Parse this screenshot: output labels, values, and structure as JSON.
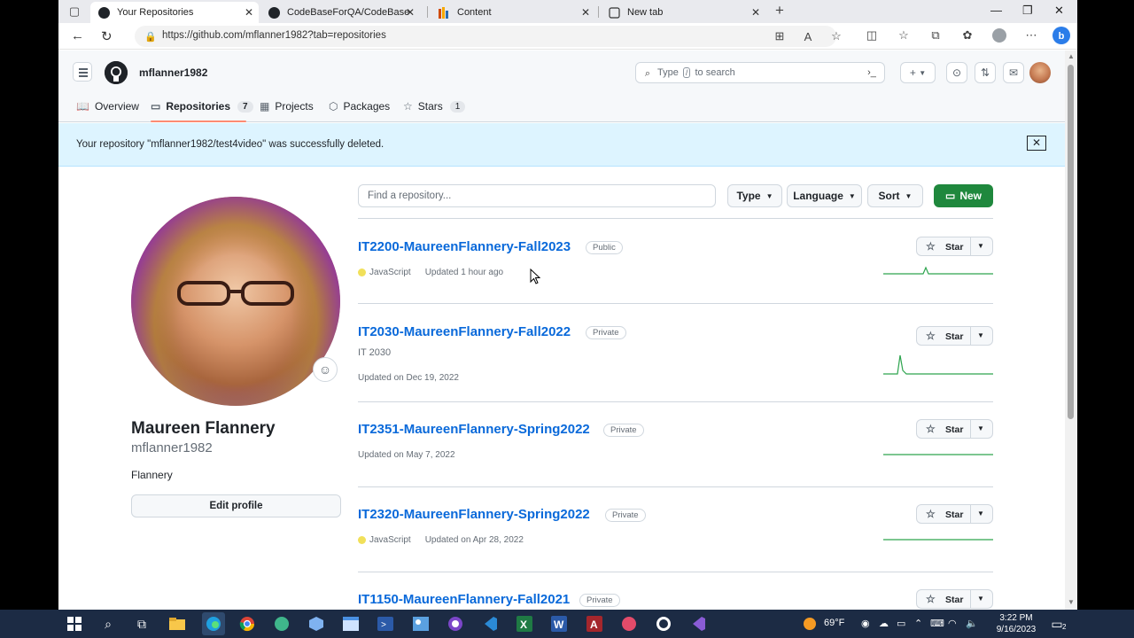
{
  "browser": {
    "tabs": [
      {
        "title": "Your Repositories",
        "active": true
      },
      {
        "title": "CodeBaseForQA/CodeBase at m",
        "active": false
      },
      {
        "title": "Content",
        "active": false
      },
      {
        "title": "New tab",
        "active": false
      }
    ],
    "url": "https://github.com/mflanner1982?tab=repositories"
  },
  "github": {
    "username": "mflanner1982",
    "search_placeholder_pre": "Type",
    "search_slash": "/",
    "search_placeholder_post": "to search",
    "nav": [
      {
        "label": "Overview",
        "icon": "book-icon",
        "count": null
      },
      {
        "label": "Repositories",
        "icon": "repo-icon",
        "count": "7"
      },
      {
        "label": "Projects",
        "icon": "table-icon",
        "count": null
      },
      {
        "label": "Packages",
        "icon": "package-icon",
        "count": null
      },
      {
        "label": "Stars",
        "icon": "star-icon",
        "count": "1"
      }
    ],
    "flash_message": "Your repository \"mflanner1982/test4video\" was successfully deleted."
  },
  "profile": {
    "name": "Maureen Flannery",
    "login": "mflanner1982",
    "bio": "Flannery",
    "edit_label": "Edit profile"
  },
  "filters": {
    "find_placeholder": "Find a repository...",
    "type_label": "Type",
    "language_label": "Language",
    "sort_label": "Sort",
    "new_label": "New"
  },
  "repos": [
    {
      "name": "IT2200-MaureenFlannery-Fall2023",
      "visibility": "Public",
      "description": "",
      "language": "JavaScript",
      "updated": "Updated 1 hour ago",
      "star_label": "Star"
    },
    {
      "name": "IT2030-MaureenFlannery-Fall2022",
      "visibility": "Private",
      "description": "IT 2030",
      "language": "",
      "updated": "Updated on Dec 19, 2022",
      "star_label": "Star"
    },
    {
      "name": "IT2351-MaureenFlannery-Spring2022",
      "visibility": "Private",
      "description": "",
      "language": "",
      "updated": "Updated on May 7, 2022",
      "star_label": "Star"
    },
    {
      "name": "IT2320-MaureenFlannery-Spring2022",
      "visibility": "Private",
      "description": "",
      "language": "JavaScript",
      "updated": "Updated on Apr 28, 2022",
      "star_label": "Star"
    },
    {
      "name": "IT1150-MaureenFlannery-Fall2021",
      "visibility": "Private",
      "description": "",
      "language": "",
      "updated": "",
      "star_label": "Star"
    }
  ],
  "colors": {
    "accent": "#0969da",
    "new_button": "#1f883d",
    "flash_bg": "#ddf4ff",
    "javascript": "#f1e05a"
  },
  "taskbar": {
    "weather": "69°F",
    "time": "3:22 PM",
    "date": "9/16/2023",
    "notifications": "2"
  }
}
